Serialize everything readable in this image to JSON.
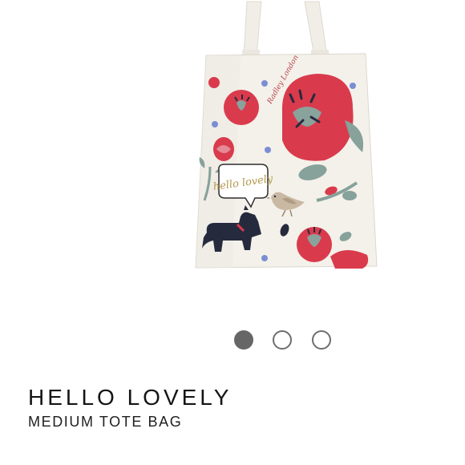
{
  "product": {
    "title": "HELLO LOVELY",
    "subtitle": "MEDIUM TOTE BAG",
    "print": {
      "speech_bubble_text": "hello lovely",
      "signature_text": "Radley London"
    }
  },
  "gallery": {
    "image_count": 3,
    "active_index": 0
  },
  "colors": {
    "bag": "#f4f1ea",
    "poppy_red": "#d93b4d",
    "leaf_green": "#86a29a",
    "dog_navy": "#262a3d",
    "dot_active": "#666666",
    "dot_inactive_border": "#6d6d6d"
  }
}
